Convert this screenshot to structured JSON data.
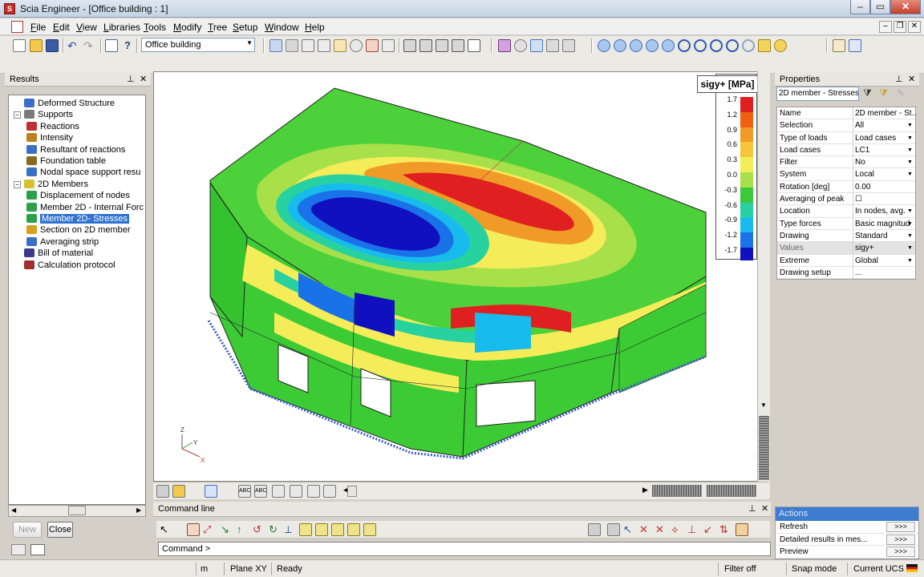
{
  "window": {
    "title": "Scia Engineer - [Office building : 1]"
  },
  "menu": [
    "File",
    "Edit",
    "View",
    "Libraries",
    "Tools",
    "Modify",
    "Tree",
    "Setup",
    "Window",
    "Help"
  ],
  "toolbar": {
    "project": "Office building"
  },
  "results": {
    "title": "Results",
    "items": [
      {
        "label": "Deformed Structure",
        "level": 1
      },
      {
        "label": "Supports",
        "level": 1
      },
      {
        "label": "Reactions",
        "level": 2
      },
      {
        "label": "Intensity",
        "level": 2
      },
      {
        "label": "Resultant of reactions",
        "level": 2
      },
      {
        "label": "Foundation table",
        "level": 2
      },
      {
        "label": "Nodal space support resu",
        "level": 2
      },
      {
        "label": "2D Members",
        "level": 1
      },
      {
        "label": "Displacement of nodes",
        "level": 2
      },
      {
        "label": "Member 2D - Internal Forc",
        "level": 2
      },
      {
        "label": "Member 2D- Stresses",
        "level": 2
      },
      {
        "label": "Section on 2D member",
        "level": 2
      },
      {
        "label": "Averaging strip",
        "level": 2
      },
      {
        "label": "Bill of material",
        "level": 1
      },
      {
        "label": "Calculation protocol",
        "level": 1
      }
    ],
    "selected_index": 10,
    "new_label": "New",
    "close_label": "Close"
  },
  "legend": {
    "title": "sigy+ [MPa]",
    "values": [
      "1.7",
      "1.2",
      "0.9",
      "0.6",
      "0.3",
      "0.0",
      "-0.3",
      "-0.6",
      "-0.9",
      "-1.2",
      "-1.7"
    ],
    "colors": [
      "#e02020",
      "#f06010",
      "#f09a28",
      "#f5c53a",
      "#f5ec5a",
      "#a8e04a",
      "#3cc83c",
      "#28d2a0",
      "#18bcec",
      "#1a72e8",
      "#1010c0"
    ]
  },
  "command": {
    "title": "Command line",
    "prompt": "Command >"
  },
  "properties": {
    "title": "Properties",
    "combo": "2D member - Stresses",
    "rows": [
      {
        "name": "Name",
        "value": "2D member - St...",
        "dropdown": false
      },
      {
        "name": "Selection",
        "value": "All",
        "dropdown": true
      },
      {
        "name": "Type of loads",
        "value": "Load cases",
        "dropdown": true
      },
      {
        "name": "Load cases",
        "value": "LC1",
        "dropdown": true
      },
      {
        "name": "Filter",
        "value": "No",
        "dropdown": true
      },
      {
        "name": "System",
        "value": "Local",
        "dropdown": true
      },
      {
        "name": "Rotation [deg]",
        "value": "0.00",
        "dropdown": false
      },
      {
        "name": "Averaging of peak",
        "value": "☐",
        "dropdown": false
      },
      {
        "name": "Location",
        "value": "In nodes, avg.",
        "dropdown": true
      },
      {
        "name": "Type forces",
        "value": "Basic magnitud",
        "dropdown": true
      },
      {
        "name": "Drawing",
        "value": "Standard",
        "dropdown": true
      },
      {
        "name": "Values",
        "value": "sigy+",
        "dropdown": true
      },
      {
        "name": "Extreme",
        "value": "Global",
        "dropdown": true
      },
      {
        "name": "Drawing setup",
        "value": "...",
        "dropdown": false
      }
    ],
    "highlight_index": 11
  },
  "actions": {
    "title": "Actions",
    "rows": [
      {
        "name": "Refresh",
        "btn": ">>>"
      },
      {
        "name": "Detailed results in mes...",
        "btn": ">>>"
      },
      {
        "name": "Preview",
        "btn": ">>>"
      }
    ]
  },
  "status": {
    "unit": "m",
    "plane": "Plane XY",
    "state": "Ready",
    "filter": "Filter off",
    "snap": "Snap mode",
    "ucs": "Current UCS"
  },
  "axes": {
    "z": "Z",
    "y": "Y",
    "x": "X"
  }
}
